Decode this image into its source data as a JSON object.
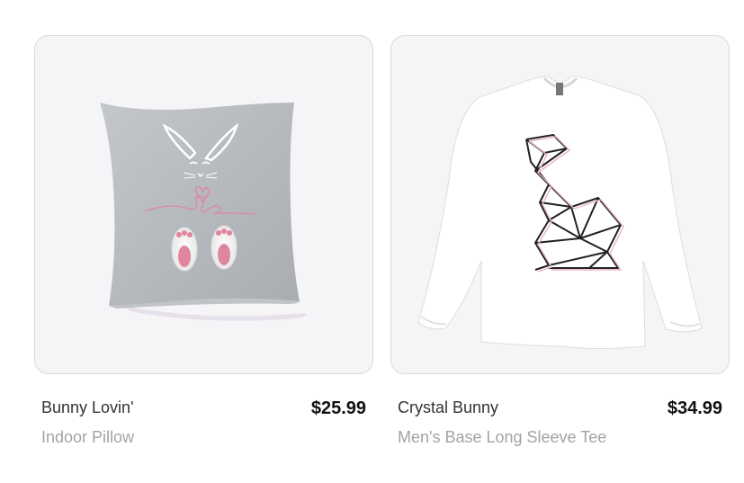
{
  "products": [
    {
      "name": "Bunny Lovin'",
      "type": "Indoor Pillow",
      "price": "$25.99",
      "image_icon": "bunny-pillow-image"
    },
    {
      "name": "Crystal Bunny",
      "type": "Men's Base Long Sleeve Tee",
      "price": "$34.99",
      "image_icon": "crystal-bunny-tee-image"
    }
  ],
  "colors": {
    "card_background": "#f5f5f8",
    "card_border": "#d9d9de",
    "pillow_fabric": "#b8bcc0",
    "accent_pink": "#e0859f",
    "name_text": "#333333",
    "type_text": "#a3a3a3",
    "price_text": "#111111"
  }
}
